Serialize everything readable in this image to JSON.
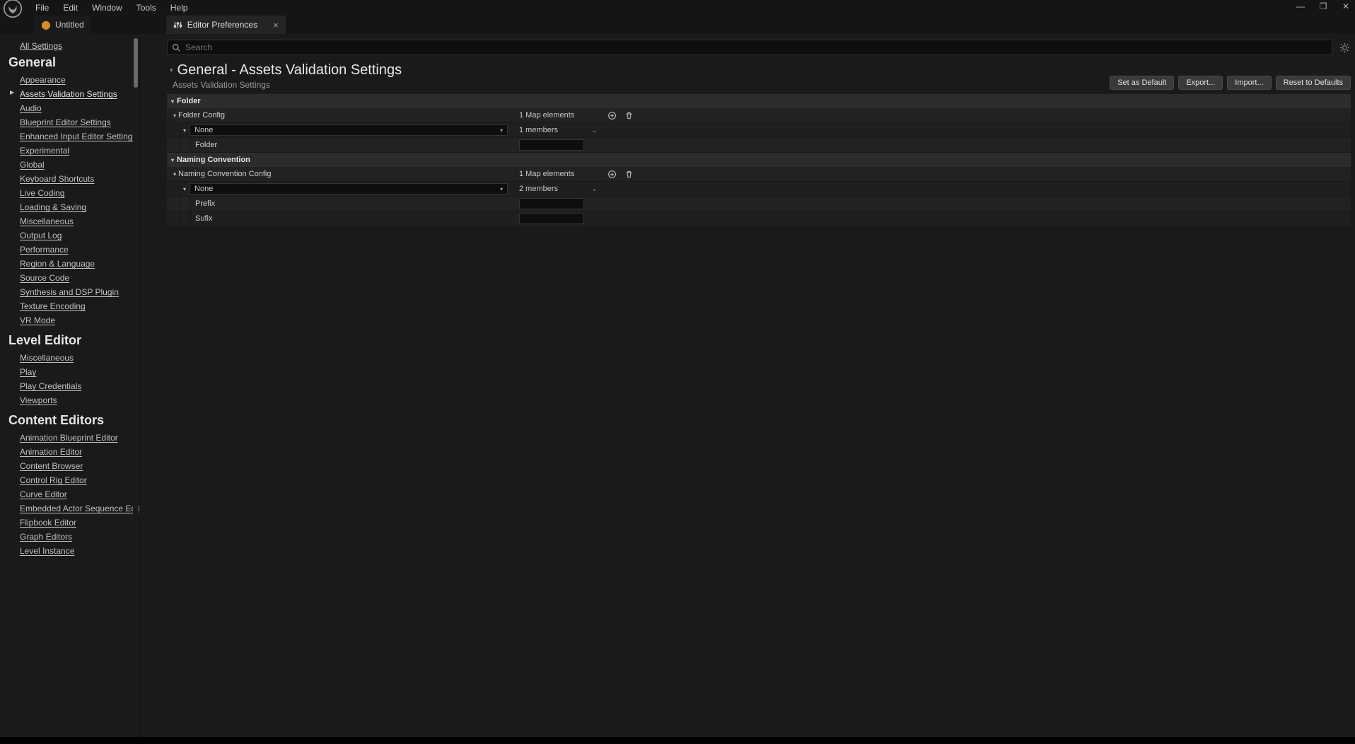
{
  "menu": {
    "items": [
      "File",
      "Edit",
      "Window",
      "Tools",
      "Help"
    ]
  },
  "tabs": {
    "t0": {
      "label": "Untitled"
    },
    "t1": {
      "label": "Editor Preferences"
    }
  },
  "sidebar": {
    "all": "All Settings",
    "groups": [
      {
        "title": "General",
        "items": [
          "Appearance",
          "Assets Validation Settings",
          "Audio",
          "Blueprint Editor Settings",
          "Enhanced Input Editor Settings",
          "Experimental",
          "Global",
          "Keyboard Shortcuts",
          "Live Coding",
          "Loading & Saving",
          "Miscellaneous",
          "Output Log",
          "Performance",
          "Region & Language",
          "Source Code",
          "Synthesis and DSP Plugin",
          "Texture Encoding",
          "VR Mode"
        ]
      },
      {
        "title": "Level Editor",
        "items": [
          "Miscellaneous",
          "Play",
          "Play Credentials",
          "Viewports"
        ]
      },
      {
        "title": "Content Editors",
        "items": [
          "Animation Blueprint Editor",
          "Animation Editor",
          "Content Browser",
          "Control Rig Editor",
          "Curve Editor",
          "Embedded Actor Sequence Editor",
          "Flipbook Editor",
          "Graph Editors",
          "Level Instance"
        ]
      }
    ],
    "selected": "Assets Validation Settings"
  },
  "search": {
    "placeholder": "Search"
  },
  "header": {
    "title": "General - Assets Validation Settings",
    "subtitle": "Assets Validation Settings",
    "buttons": {
      "b0": "Set as Default",
      "b1": "Export...",
      "b2": "Import...",
      "b3": "Reset to Defaults"
    }
  },
  "props": {
    "cat0": "Folder",
    "folder_config": "Folder Config",
    "folder_config_info": "1 Map elements",
    "folder_none": "None",
    "folder_members": "1 members",
    "folder_key": "Folder",
    "cat1": "Naming Convention",
    "nc_config": "Naming Convention Config",
    "nc_config_info": "1 Map elements",
    "nc_none": "None",
    "nc_members": "2 members",
    "nc_prefix": "Prefix",
    "nc_sufix": "Sufix"
  }
}
